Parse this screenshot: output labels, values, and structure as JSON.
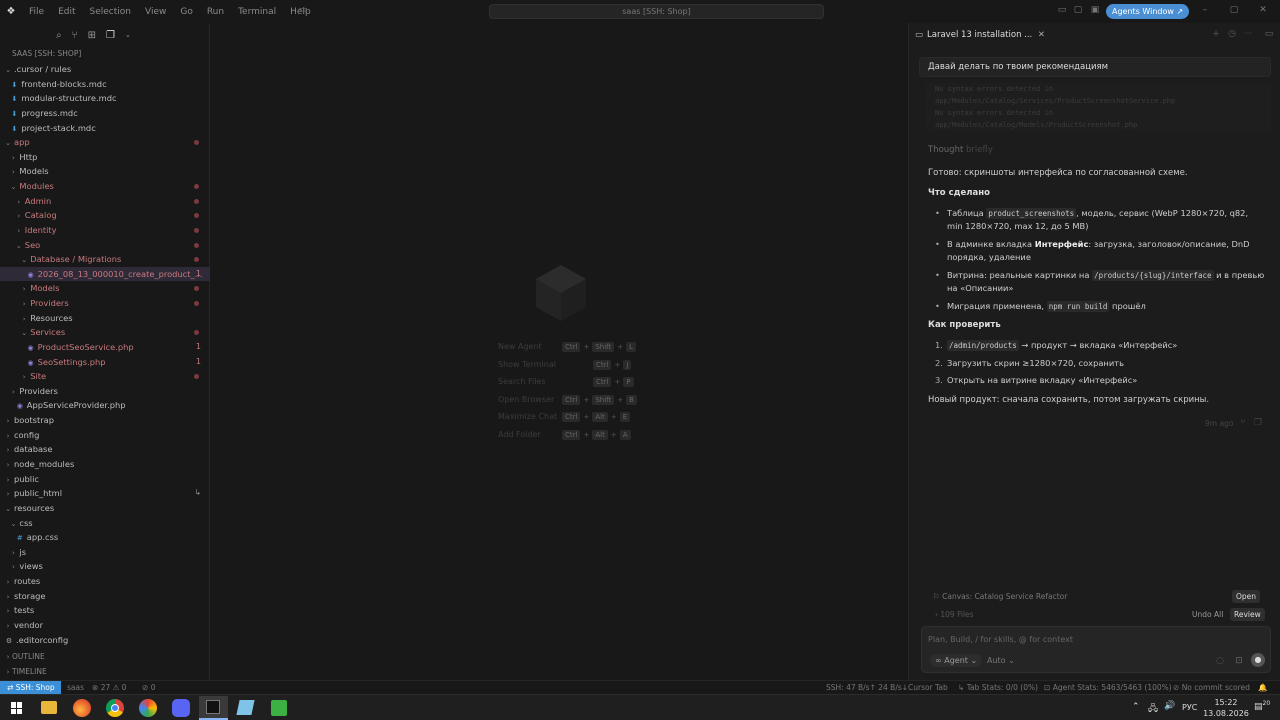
{
  "menu": [
    "File",
    "Edit",
    "Selection",
    "View",
    "Go",
    "Run",
    "Terminal",
    "Help"
  ],
  "search_label": "saas [SSH: Shop]",
  "agents_window": "Agents Window ↗",
  "sidebar": {
    "root": "SAAS [SSH: SHOP]",
    "outline": "OUTLINE",
    "timeline": "TIMELINE",
    "rows": [
      {
        "label": ".cursor / rules",
        "depth": 1,
        "kind": "folder-open"
      },
      {
        "label": "frontend-blocks.mdc",
        "depth": 2,
        "kind": "md"
      },
      {
        "label": "modular-structure.mdc",
        "depth": 2,
        "kind": "md"
      },
      {
        "label": "progress.mdc",
        "depth": 2,
        "kind": "md"
      },
      {
        "label": "project-stack.mdc",
        "depth": 2,
        "kind": "md"
      },
      {
        "label": "app",
        "depth": 1,
        "kind": "folder-open",
        "color": "#c97a7e",
        "dot": true
      },
      {
        "label": "Http",
        "depth": 2,
        "kind": "folder"
      },
      {
        "label": "Models",
        "depth": 2,
        "kind": "folder"
      },
      {
        "label": "Modules",
        "depth": 2,
        "kind": "folder-open",
        "color": "#c97a7e",
        "dot": true
      },
      {
        "label": "Admin",
        "depth": 3,
        "kind": "folder",
        "color": "#c97a7e",
        "dot": true
      },
      {
        "label": "Catalog",
        "depth": 3,
        "kind": "folder",
        "color": "#c97a7e",
        "dot": true
      },
      {
        "label": "Identity",
        "depth": 3,
        "kind": "folder",
        "color": "#c97a7e",
        "dot": true
      },
      {
        "label": "Seo",
        "depth": 3,
        "kind": "folder-open",
        "color": "#c97a7e",
        "dot": true
      },
      {
        "label": "Database / Migrations",
        "depth": 4,
        "kind": "folder-open",
        "color": "#c97a7e",
        "dot": true
      },
      {
        "label": "2026_08_13_000010_create_product_...",
        "depth": 5,
        "kind": "php",
        "color": "#c97a7e",
        "badge": "1",
        "selected": true
      },
      {
        "label": "Models",
        "depth": 4,
        "kind": "folder",
        "color": "#c97a7e",
        "dot": true
      },
      {
        "label": "Providers",
        "depth": 4,
        "kind": "folder",
        "color": "#c97a7e",
        "dot": true
      },
      {
        "label": "Resources",
        "depth": 4,
        "kind": "folder"
      },
      {
        "label": "Services",
        "depth": 4,
        "kind": "folder-open",
        "color": "#c97a7e",
        "dot": true
      },
      {
        "label": "ProductSeoService.php",
        "depth": 5,
        "kind": "php",
        "color": "#c97a7e",
        "badge": "1"
      },
      {
        "label": "SeoSettings.php",
        "depth": 5,
        "kind": "php",
        "color": "#c97a7e",
        "badge": "1"
      },
      {
        "label": "Site",
        "depth": 4,
        "kind": "folder",
        "color": "#c97a7e",
        "dot": true
      },
      {
        "label": "Providers",
        "depth": 2,
        "kind": "folder"
      },
      {
        "label": "AppServiceProvider.php",
        "depth": 3,
        "kind": "php"
      },
      {
        "label": "bootstrap",
        "depth": 1,
        "kind": "folder"
      },
      {
        "label": "config",
        "depth": 1,
        "kind": "folder"
      },
      {
        "label": "database",
        "depth": 1,
        "kind": "folder"
      },
      {
        "label": "node_modules",
        "depth": 1,
        "kind": "folder"
      },
      {
        "label": "public",
        "depth": 1,
        "kind": "folder"
      },
      {
        "label": "public_html",
        "depth": 1,
        "kind": "folder",
        "badge": "↳"
      },
      {
        "label": "resources",
        "depth": 1,
        "kind": "folder-open"
      },
      {
        "label": "css",
        "depth": 2,
        "kind": "folder-open"
      },
      {
        "label": "app.css",
        "depth": 3,
        "kind": "css"
      },
      {
        "label": "js",
        "depth": 2,
        "kind": "folder"
      },
      {
        "label": "views",
        "depth": 2,
        "kind": "folder"
      },
      {
        "label": "routes",
        "depth": 1,
        "kind": "folder"
      },
      {
        "label": "storage",
        "depth": 1,
        "kind": "folder"
      },
      {
        "label": "tests",
        "depth": 1,
        "kind": "folder"
      },
      {
        "label": "vendor",
        "depth": 1,
        "kind": "folder"
      },
      {
        "label": ".editorconfig",
        "depth": 1,
        "kind": "gear"
      }
    ]
  },
  "editor": {
    "shortcuts": [
      {
        "label": "New Agent",
        "keys": [
          "Ctrl",
          "Shift",
          "L"
        ]
      },
      {
        "label": "Show Terminal",
        "keys": [
          "Ctrl",
          "J"
        ]
      },
      {
        "label": "Search Files",
        "keys": [
          "Ctrl",
          "P"
        ]
      },
      {
        "label": "Open Browser",
        "keys": [
          "Ctrl",
          "Shift",
          "B"
        ]
      },
      {
        "label": "Maximize Chat",
        "keys": [
          "Ctrl",
          "Alt",
          "E"
        ]
      },
      {
        "label": "Add Folder",
        "keys": [
          "Ctrl",
          "Alt",
          "A"
        ]
      }
    ]
  },
  "chat": {
    "tab_title": "Laravel 13 installation ...",
    "user_message": "Давай делать по твоим рекомендациям",
    "code_lines": [
      "No syntax errors detected in",
      "app/Modules/Catalog/Services/ProductScreenshotService.php",
      "No syntax errors detected in",
      "app/Modules/Catalog/Models/ProductScreenshot.php"
    ],
    "thought_label": "Thought",
    "thought_duration": "briefly",
    "done_text": "Готово: скриншоты интерфейса по согласованной схеме.",
    "what_done_heading": "Что сделано",
    "bullets": [
      {
        "pre": "Таблица ",
        "code": "product_screenshots",
        "post": ", модель, сервис (WebP 1280×720, q82, min 1280×720, max 12, до 5 MB)"
      },
      {
        "pre": "В админке вкладка ",
        "bold": "Интерфейс",
        "post": ": загрузка, заголовок/описание, DnD порядка, удаление"
      },
      {
        "pre": "Витрина: реальные картинки на ",
        "code": "/products/{slug}/interface",
        "post": " и в превью на «Описании»"
      },
      {
        "pre": "Миграция применена, ",
        "code": "npm run build",
        "post": " прошёл"
      }
    ],
    "check_heading": "Как проверить",
    "steps": [
      {
        "num": "1.",
        "code": "/admin/products",
        "post": " → продукт → вкладка «Интерфейс»"
      },
      {
        "num": "2.",
        "text": "Загрузить скрин ≥1280×720, сохранить"
      },
      {
        "num": "3.",
        "text": "Открыть на витрине вкладку «Интерфейс»"
      }
    ],
    "footer_note": "Новый продукт: сначала сохранить, потом загружать скрины.",
    "time_ago": "9m ago",
    "canvas_label": "Canvas: Catalog Service Refactor",
    "open_btn": "Open",
    "files_label": "109 Files",
    "undo_all": "Undo All",
    "review_btn": "Review",
    "composer_placeholder": "Plan, Build, / for skills, @ for context",
    "mode_label": "Agent",
    "model_label": "Auto"
  },
  "status": {
    "remote": "SSH: Shop",
    "branch": "saas",
    "problems": "27",
    "warnings": "0",
    "ports": "0",
    "ssh_rate": "SSH: 47 B/s↑ 24 B/s↓",
    "cursor_tab": "Cursor Tab",
    "tab_stats": "Tab Stats: 0/0 (0%)",
    "agent_stats": "Agent Stats: 5463/5463 (100%)",
    "commit": "No commit scored"
  },
  "taskbar": {
    "lang": "РУС",
    "time": "15:22",
    "date": "13.08.2026",
    "notif": "20"
  }
}
